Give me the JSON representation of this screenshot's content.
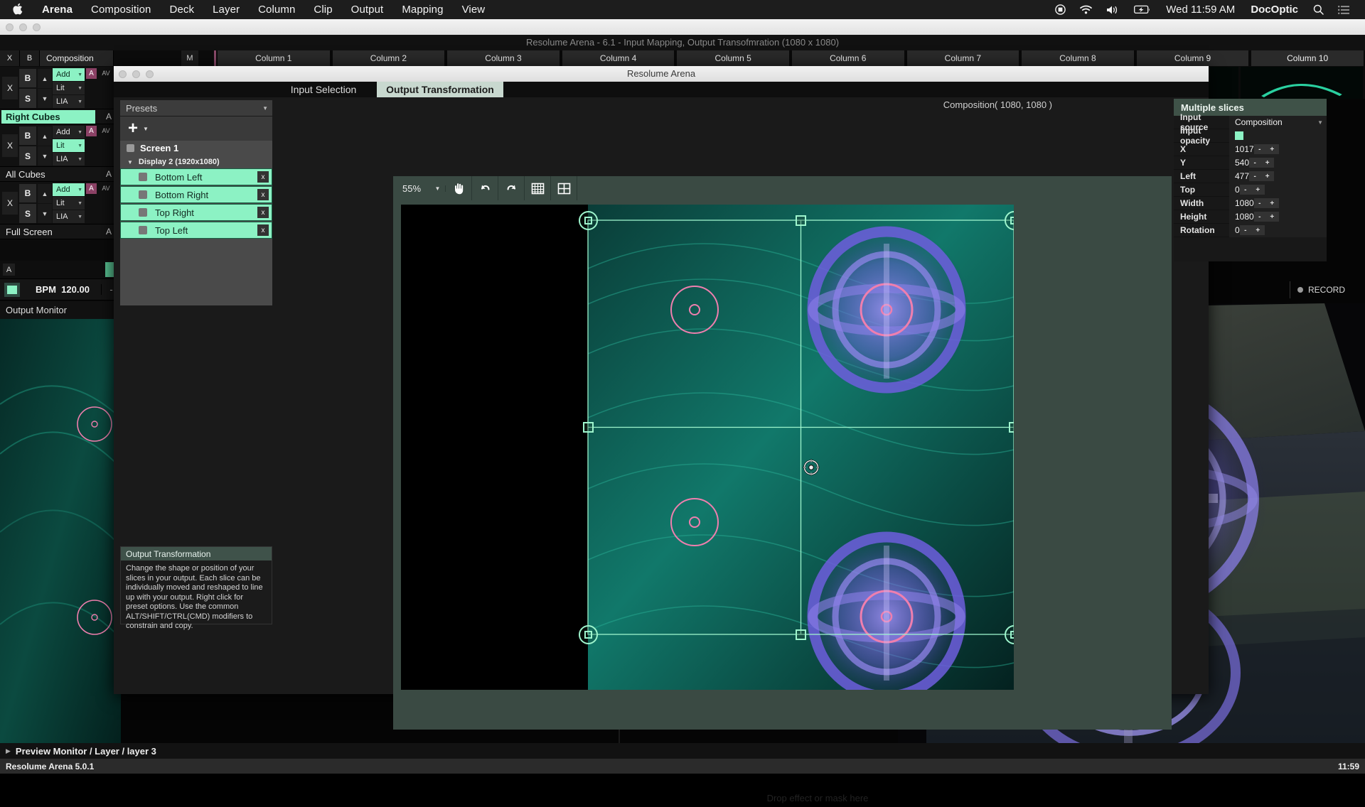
{
  "macbar": {
    "apple_icon": "apple-icon",
    "items": [
      {
        "label": "Arena",
        "bold": true
      },
      {
        "label": "Composition",
        "bold": false
      },
      {
        "label": "Deck",
        "bold": false
      },
      {
        "label": "Layer",
        "bold": false
      },
      {
        "label": "Column",
        "bold": false
      },
      {
        "label": "Clip",
        "bold": false
      },
      {
        "label": "Output",
        "bold": false
      },
      {
        "label": "Mapping",
        "bold": false
      },
      {
        "label": "View",
        "bold": false
      }
    ],
    "status": {
      "record_icon": "record-stop-icon",
      "wifi_icon": "wifi-icon",
      "volume_icon": "volume-icon",
      "battery_icon": "battery-charging-icon",
      "clock": "Wed 11:59 AM",
      "user": "DocOptic",
      "search_icon": "search-icon",
      "controlcenter_icon": "list-menu-icon"
    }
  },
  "arena": {
    "window_title": "Resolume Arena - 6.1 - Input Mapping, Output Transofmration (1080 x 1080)",
    "colstrip": {
      "x_label": "X",
      "b_label": "B",
      "composition_label": "Composition",
      "m_label": "M",
      "columns": [
        "Column 1",
        "Column 2",
        "Column 3",
        "Column 4",
        "Column 5",
        "Column 6",
        "Column 7",
        "Column 8",
        "Column 9",
        "Column 10"
      ],
      "selected_column_index": 4
    },
    "layers": [
      {
        "x": "X",
        "b": "B",
        "s": "S",
        "up": "▲",
        "down": "▼",
        "blends": [
          {
            "label": "Add",
            "active": true
          },
          {
            "label": "Lit",
            "active": false
          },
          {
            "label": "LIA",
            "active": false
          }
        ],
        "a": "A",
        "av": "AV",
        "name": "",
        "name_active": false,
        "name_a": "A"
      },
      {
        "x": "X",
        "b": "B",
        "s": "S",
        "up": "▲",
        "down": "▼",
        "blends": [
          {
            "label": "Add",
            "active": false
          },
          {
            "label": "Lit",
            "active": true
          },
          {
            "label": "LIA",
            "active": false
          }
        ],
        "a": "A",
        "av": "AV",
        "name": "Right Cubes",
        "name_active": true,
        "name_a": "A"
      },
      {
        "x": "X",
        "b": "B",
        "s": "S",
        "up": "▲",
        "down": "▼",
        "blends": [
          {
            "label": "Add",
            "active": true
          },
          {
            "label": "Lit",
            "active": false
          },
          {
            "label": "LIA",
            "active": false
          }
        ],
        "a": "A",
        "av": "AV",
        "name": "All Cubes",
        "name_active": false,
        "name_a": "A"
      }
    ],
    "layer_names_after": [
      {
        "name": "Full Screen",
        "a": "A"
      }
    ],
    "a_button": "A",
    "bpm": {
      "label": "BPM",
      "value": "120.00",
      "minus": "-"
    },
    "output_monitor_label": "Output Monitor",
    "record_label": "RECORD",
    "drop_hint": "Drop effect or mask here",
    "preview_monitor_label": "Preview Monitor / Layer / layer 3",
    "status_text": "Resolume Arena 5.0.1",
    "status_clock": "11:59"
  },
  "dialog": {
    "title": "Resolume Arena",
    "tabs": [
      {
        "label": "Input Selection",
        "active": false
      },
      {
        "label": "Output Transformation",
        "active": true
      }
    ],
    "composition_size": "Composition( 1080, 1080 )",
    "presets": {
      "label": "Presets",
      "chevron": "chevron-down-icon"
    },
    "add_button": {
      "plus": "+",
      "chevron": "chevron-down-icon"
    },
    "screen": {
      "name": "Screen 1",
      "display": "Display 2 (1920x1080)",
      "slices": [
        {
          "label": "Bottom Left",
          "close": "x"
        },
        {
          "label": "Bottom Right",
          "close": "x"
        },
        {
          "label": "Top Right",
          "close": "x"
        },
        {
          "label": "Top Left",
          "close": "x"
        }
      ]
    },
    "info": {
      "title": "Output Transformation",
      "body": "Change the shape or position of your slices in your output. Each slice can be individually moved and reshaped to line up with your output. Right click for preset options. Use the common ALT/SHIFT/CTRL(CMD) modifiers to constrain and copy."
    },
    "toolbar": {
      "zoom": "55%",
      "zoom_chevron": "chevron-down-icon",
      "tools": [
        "hand-icon",
        "undo-icon",
        "redo-icon",
        "grid-fine-icon",
        "grid-coarse-icon"
      ]
    },
    "properties": {
      "title": "Multiple slices",
      "rows": [
        {
          "key": "Input source",
          "value": "Composition",
          "type": "dropdown"
        },
        {
          "key": "Input opacity",
          "value": "",
          "type": "swatch"
        },
        {
          "key": "X",
          "value": "1017",
          "type": "number"
        },
        {
          "key": "Y",
          "value": "540",
          "type": "number"
        },
        {
          "key": "Left",
          "value": "477",
          "type": "number"
        },
        {
          "key": "Top",
          "value": "0",
          "type": "number"
        },
        {
          "key": "Width",
          "value": "1080",
          "type": "number"
        },
        {
          "key": "Height",
          "value": "1080",
          "type": "number"
        },
        {
          "key": "Rotation",
          "value": "0",
          "type": "number"
        }
      ],
      "spin_minus": "-",
      "spin_plus": "+"
    }
  },
  "colors": {
    "accent_green": "#8cf2c4",
    "panel_green": "#3a4a43",
    "magenta": "#8c4266",
    "pink": "#ef7fae",
    "purple": "#6a5ad8"
  }
}
